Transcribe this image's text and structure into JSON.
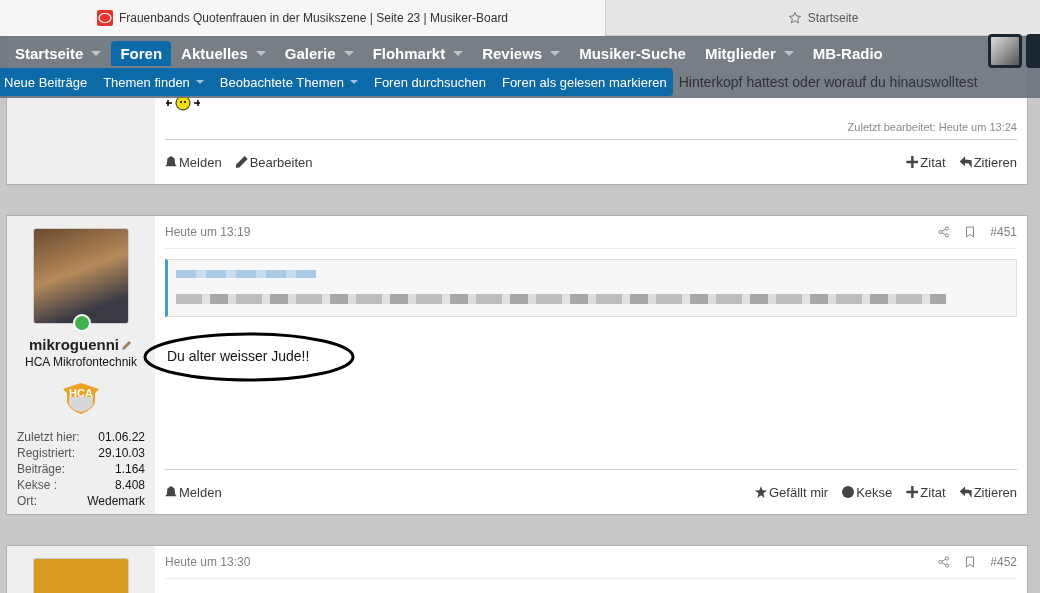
{
  "browser_tabs": [
    {
      "title": "Frauenbands Quotenfrauen in der Musikszene | Seite 23 | Musiker-Board",
      "selected": true
    },
    {
      "title": "Startseite",
      "selected": false
    }
  ],
  "nav": {
    "items": [
      {
        "label": "Startseite",
        "dropdown": true,
        "selected": false
      },
      {
        "label": "Foren",
        "dropdown": false,
        "selected": true
      },
      {
        "label": "Aktuelles",
        "dropdown": true,
        "selected": false
      },
      {
        "label": "Galerie",
        "dropdown": true,
        "selected": false
      },
      {
        "label": "Flohmarkt",
        "dropdown": true,
        "selected": false
      },
      {
        "label": "Reviews",
        "dropdown": true,
        "selected": false
      },
      {
        "label": "Musiker-Suche",
        "dropdown": false,
        "selected": false
      },
      {
        "label": "Mitglieder",
        "dropdown": true,
        "selected": false
      },
      {
        "label": "MB-Radio",
        "dropdown": false,
        "selected": false
      }
    ],
    "subnav": [
      {
        "label": "Neue Beiträge",
        "dropdown": false
      },
      {
        "label": "Themen finden",
        "dropdown": true
      },
      {
        "label": "Beobachtete Themen",
        "dropdown": true
      },
      {
        "label": "Foren durchsuchen",
        "dropdown": false
      },
      {
        "label": "Foren als gelesen markieren",
        "dropdown": false
      }
    ]
  },
  "background_text": "Hinterkopf hattest oder worauf du hinauswolltest",
  "posts": [
    {
      "kind": "tail",
      "edited": "Zuletzt bearbeitet: Heute um 13:24",
      "actions_left": [
        {
          "kind": "report",
          "label": "Melden"
        },
        {
          "kind": "edit",
          "label": "Bearbeiten"
        }
      ],
      "actions_right": [
        {
          "kind": "quote",
          "label": "Zitat"
        },
        {
          "kind": "reply",
          "label": "Zitieren"
        }
      ]
    },
    {
      "kind": "full",
      "date": "Heute um 13:19",
      "number": "#451",
      "user": {
        "name": "mikroguenni",
        "title": "HCA Mikrofontechnik",
        "badge": "HCA",
        "online": true,
        "stats": [
          {
            "label": "Zuletzt hier:",
            "value": "01.06.22"
          },
          {
            "label": "Registriert:",
            "value": "29.10.03"
          },
          {
            "label": "Beiträge:",
            "value": "1.164"
          },
          {
            "label": "Kekse :",
            "value": "8.408"
          },
          {
            "label": "Ort:",
            "value": "Wedemark"
          }
        ]
      },
      "message": "Du alter weisser Jude!!",
      "circled": true,
      "actions_left": [
        {
          "kind": "report",
          "label": "Melden"
        }
      ],
      "actions_right": [
        {
          "kind": "like",
          "label": "Gefällt mir"
        },
        {
          "kind": "cookie",
          "label": "Kekse"
        },
        {
          "kind": "quote",
          "label": "Zitat"
        },
        {
          "kind": "reply",
          "label": "Zitieren"
        }
      ]
    },
    {
      "kind": "head",
      "date": "Heute um 13:30",
      "number": "#452"
    }
  ]
}
